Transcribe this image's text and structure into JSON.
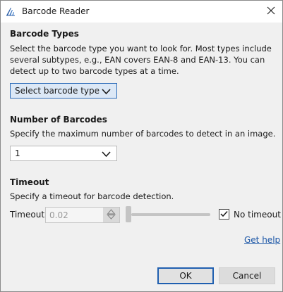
{
  "window": {
    "title": "Barcode Reader"
  },
  "barcode_types": {
    "heading": "Barcode Types",
    "description": "Select the barcode type you want to look for. Most types include several subtypes, e.g., EAN covers EAN-8 and EAN-13. You can detect up to two barcode types at a time.",
    "dropdown_value": "Select barcode type"
  },
  "number_of_barcodes": {
    "heading": "Number of Barcodes",
    "description": "Specify the maximum number of barcodes to detect in an image.",
    "dropdown_value": "1"
  },
  "timeout": {
    "heading": "Timeout",
    "description": "Specify a timeout for barcode detection.",
    "label": "Timeout",
    "input_value": "0.02",
    "slider_level": 0,
    "no_timeout_label": "No timeout",
    "no_timeout_checked": true
  },
  "help_link": "Get help",
  "buttons": {
    "ok": "OK",
    "cancel": "Cancel"
  },
  "colors": {
    "accent": "#2d6cb8",
    "link": "#1a55a6",
    "disabled_text": "#9a9a9a"
  },
  "icons": {
    "app": "app-logo-icon",
    "close": "close-icon",
    "dropdown": "chevron-down-icon",
    "spinner": "spinner-arrows-icon",
    "check": "checkmark-icon"
  }
}
